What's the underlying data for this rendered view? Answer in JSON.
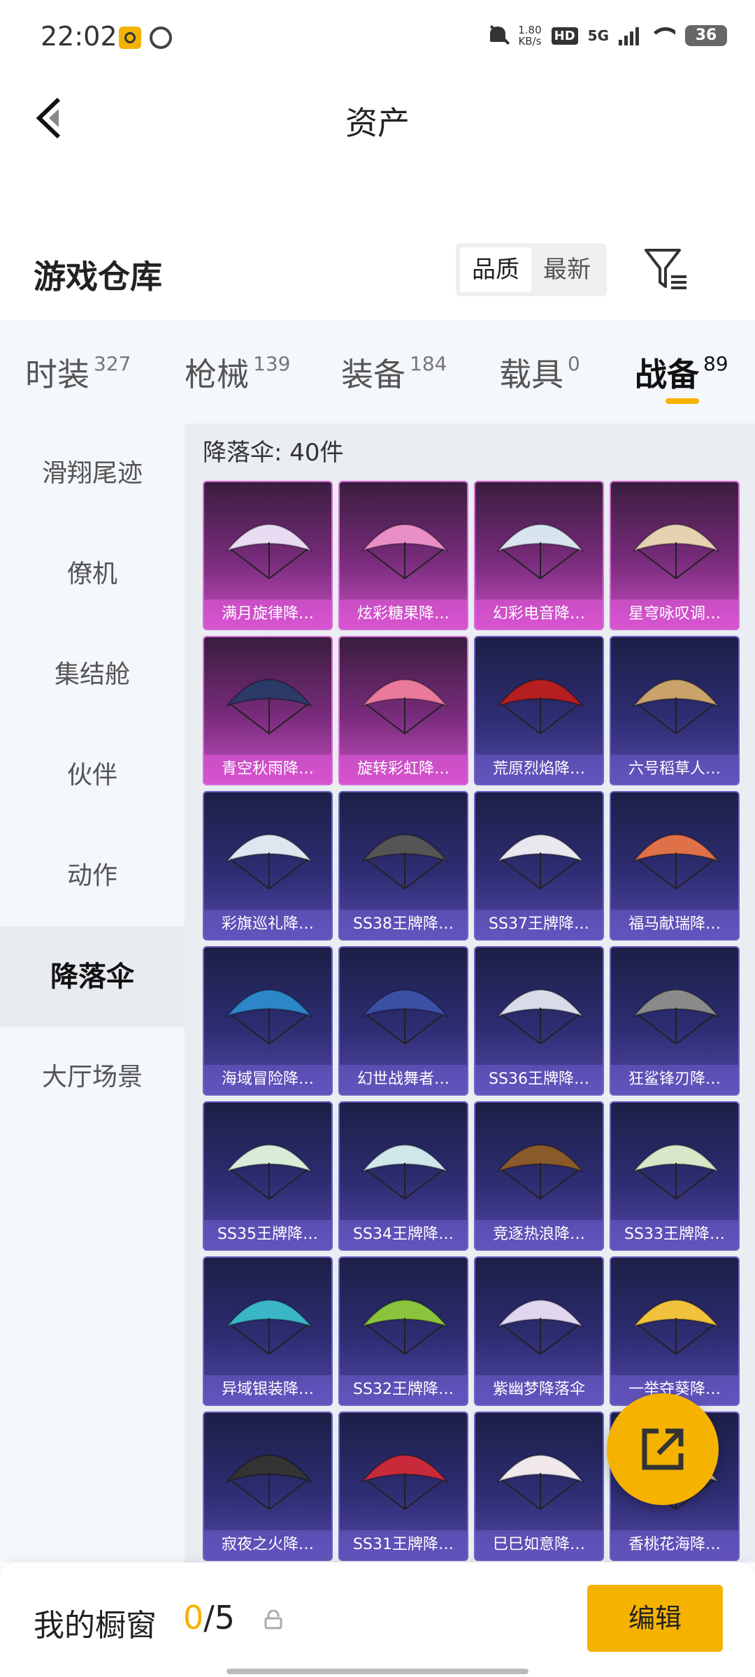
{
  "status_bar": {
    "time": "22:02",
    "speed_value": "1.80",
    "speed_unit": "KB/s",
    "hd_badge": "HD",
    "network": "5G",
    "battery": "36"
  },
  "header": {
    "title": "资产",
    "back_icon": "chevron-left-icon"
  },
  "warehouse": {
    "title": "游戏仓库",
    "sort_options": [
      "品质",
      "最新"
    ],
    "sort_selected": "品质",
    "filter_icon": "filter-icon"
  },
  "tabs": [
    {
      "label": "时装",
      "count": "327"
    },
    {
      "label": "枪械",
      "count": "139"
    },
    {
      "label": "装备",
      "count": "184"
    },
    {
      "label": "载具",
      "count": "0"
    },
    {
      "label": "战备",
      "count": "89"
    }
  ],
  "active_tab": "战备",
  "sidebar": {
    "items": [
      "滑翔尾迹",
      "僚机",
      "集结舱",
      "伙伴",
      "动作",
      "降落伞",
      "大厅场景"
    ],
    "active": "降落伞"
  },
  "grid": {
    "header": "降落伞: 40件",
    "items": [
      {
        "label": "满月旋律降…",
        "rarity": "pink"
      },
      {
        "label": "炫彩糖果降…",
        "rarity": "pink"
      },
      {
        "label": "幻彩电音降…",
        "rarity": "pink"
      },
      {
        "label": "星穹咏叹调…",
        "rarity": "pink"
      },
      {
        "label": "青空秋雨降…",
        "rarity": "pink"
      },
      {
        "label": "旋转彩虹降…",
        "rarity": "pink"
      },
      {
        "label": "荒原烈焰降…",
        "rarity": "purple"
      },
      {
        "label": "六号稻草人…",
        "rarity": "purple"
      },
      {
        "label": "彩旗巡礼降…",
        "rarity": "purple"
      },
      {
        "label": "SS38王牌降…",
        "rarity": "purple"
      },
      {
        "label": "SS37王牌降…",
        "rarity": "purple"
      },
      {
        "label": "福马献瑞降…",
        "rarity": "purple"
      },
      {
        "label": "海域冒险降…",
        "rarity": "purple"
      },
      {
        "label": "幻世战舞者…",
        "rarity": "purple"
      },
      {
        "label": "SS36王牌降…",
        "rarity": "purple"
      },
      {
        "label": "狂鲨锋刃降…",
        "rarity": "purple"
      },
      {
        "label": "SS35王牌降…",
        "rarity": "purple"
      },
      {
        "label": "SS34王牌降…",
        "rarity": "purple"
      },
      {
        "label": "竞逐热浪降…",
        "rarity": "purple"
      },
      {
        "label": "SS33王牌降…",
        "rarity": "purple"
      },
      {
        "label": "异域银装降…",
        "rarity": "purple"
      },
      {
        "label": "SS32王牌降…",
        "rarity": "purple"
      },
      {
        "label": "紫幽梦降落伞",
        "rarity": "purple"
      },
      {
        "label": "一举夺葵降…",
        "rarity": "purple"
      },
      {
        "label": "寂夜之火降…",
        "rarity": "purple"
      },
      {
        "label": "SS31王牌降…",
        "rarity": "purple"
      },
      {
        "label": "巳巳如意降…",
        "rarity": "purple"
      },
      {
        "label": "香桃花海降…",
        "rarity": "purple"
      }
    ]
  },
  "fab": {
    "icon": "share-external-icon"
  },
  "bottom_bar": {
    "label": "我的橱窗",
    "current": "0",
    "separator": "/",
    "total": "5",
    "lock_icon": "lock-icon",
    "edit_label": "编辑"
  },
  "colors": {
    "accent": "#f5b300",
    "rarity_pink": "#c64fc2",
    "rarity_purple": "#5248a6"
  }
}
